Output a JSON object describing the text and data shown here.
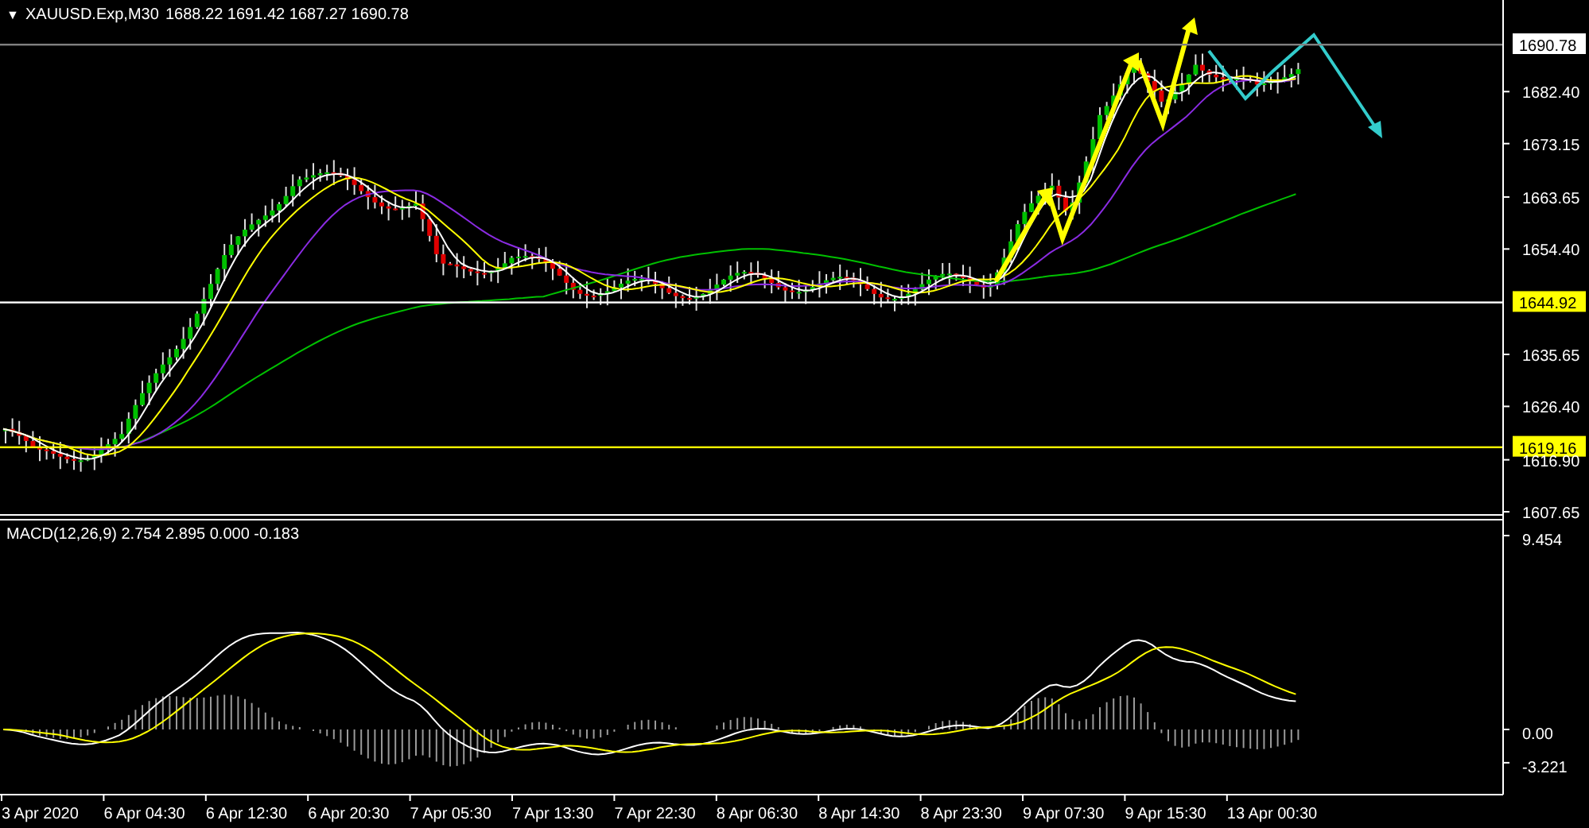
{
  "header": {
    "collapse_glyph": "▼",
    "symbol": "XAUUSD.Exp,M30",
    "quote": "1688.22 1691.42 1687.27 1690.78"
  },
  "price_axis": {
    "ticks": [
      "1682.40",
      "1673.15",
      "1663.65",
      "1654.40",
      "1635.65",
      "1626.40",
      "1616.90",
      "1607.65"
    ]
  },
  "price_levels": [
    {
      "kind": "current",
      "label": "1690.78",
      "color": "#808080"
    },
    {
      "kind": "hline",
      "label": "1644.92",
      "color": "#ffffff"
    },
    {
      "kind": "hline",
      "label": "1619.16",
      "color": "#ffff00"
    }
  ],
  "macd": {
    "label": "MACD(12,26,9) 2.754 2.895 0.000 -0.183",
    "ticks": [
      "9.454",
      "0.00",
      "-3.221"
    ]
  },
  "time_axis": {
    "labels": [
      "3 Apr 2020",
      "6 Apr 04:30",
      "6 Apr 12:30",
      "6 Apr 20:30",
      "7 Apr 05:30",
      "7 Apr 13:30",
      "7 Apr 22:30",
      "8 Apr 06:30",
      "8 Apr 14:30",
      "8 Apr 23:30",
      "9 Apr 07:30",
      "9 Apr 15:30",
      "13 Apr 00:30"
    ]
  }
}
